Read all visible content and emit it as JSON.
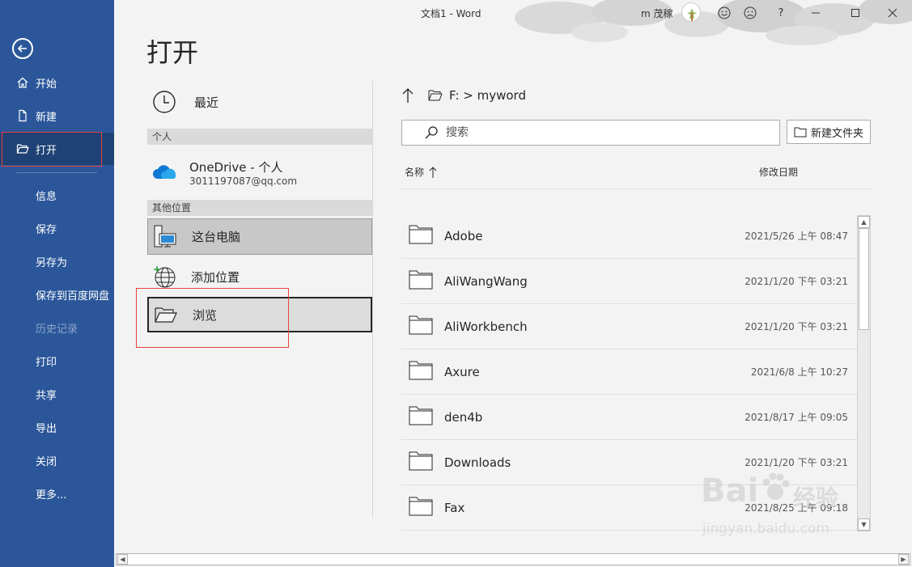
{
  "window": {
    "title": "文档1  -  Word",
    "user_name": "m 茂稼",
    "help_label": "?"
  },
  "sidebar": {
    "items": [
      {
        "label": "开始"
      },
      {
        "label": "新建"
      },
      {
        "label": "打开"
      },
      {
        "label": "信息"
      },
      {
        "label": "保存"
      },
      {
        "label": "另存为"
      },
      {
        "label": "保存到百度网盘"
      },
      {
        "label": "历史记录"
      },
      {
        "label": "打印"
      },
      {
        "label": "共享"
      },
      {
        "label": "导出"
      },
      {
        "label": "关闭"
      },
      {
        "label": "更多..."
      }
    ]
  },
  "page": {
    "title": "打开"
  },
  "locations": {
    "recent": "最近",
    "section_personal": "个人",
    "onedrive_name": "OneDrive - 个人",
    "onedrive_email": "3011197087@qq.com",
    "section_other": "其他位置",
    "this_pc": "这台电脑",
    "add_place": "添加位置",
    "browse": "浏览"
  },
  "files_panel": {
    "path": "F: > myword",
    "search_placeholder": "搜索",
    "new_folder_label": "新建文件夹",
    "col_name": "名称",
    "col_modified": "修改日期",
    "files": [
      {
        "name": "Adobe",
        "date": "2021/5/26 上午 08:47"
      },
      {
        "name": "AliWangWang",
        "date": "2021/1/20 下午 03:21"
      },
      {
        "name": "AliWorkbench",
        "date": "2021/1/20 下午 03:21"
      },
      {
        "name": "Axure",
        "date": "2021/6/8 上午 10:27"
      },
      {
        "name": "den4b",
        "date": "2021/8/17 上午 09:05"
      },
      {
        "name": "Downloads",
        "date": "2021/1/20 下午 03:21"
      },
      {
        "name": "Fax",
        "date": "2021/8/25 上午 09:18"
      }
    ]
  },
  "watermark": {
    "brand": "Bai",
    "brand_suffix": "经验",
    "domain": "jingyan.baidu.com"
  },
  "colors": {
    "sidebar": "#2b579a",
    "highlight_box": "#e84040"
  }
}
